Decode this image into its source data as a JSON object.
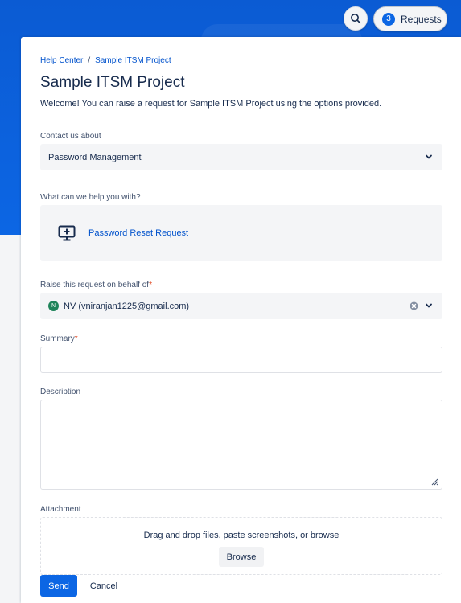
{
  "topbar": {
    "search_icon": "search-icon",
    "requests_count": "3",
    "requests_label": "Requests"
  },
  "breadcrumb": {
    "home": "Help Center",
    "separator": "/",
    "current": "Sample ITSM Project"
  },
  "page": {
    "title": "Sample ITSM Project",
    "welcome": "Welcome! You can raise a request for Sample ITSM Project using the options provided."
  },
  "contact": {
    "label": "Contact us about",
    "selected": "Password Management"
  },
  "help": {
    "label": "What can we help you with?",
    "card_label": "Password Reset Request",
    "card_icon": "monitor-plus-icon"
  },
  "behalf": {
    "label": "Raise this request on behalf of",
    "required": "*",
    "avatar_initials": "N",
    "value": "NV (vniranjan1225@gmail.com)"
  },
  "summary": {
    "label": "Summary",
    "required": "*",
    "value": ""
  },
  "description": {
    "label": "Description",
    "value": ""
  },
  "attachment": {
    "label": "Attachment",
    "dropzone_text": "Drag and drop files, paste screenshots, or browse",
    "browse_label": "Browse"
  },
  "actions": {
    "send_label": "Send",
    "cancel_label": "Cancel"
  },
  "colors": {
    "brand": "#0c66e4",
    "link": "#0052cc",
    "required": "#de350b",
    "avatar": "#1f845a"
  }
}
